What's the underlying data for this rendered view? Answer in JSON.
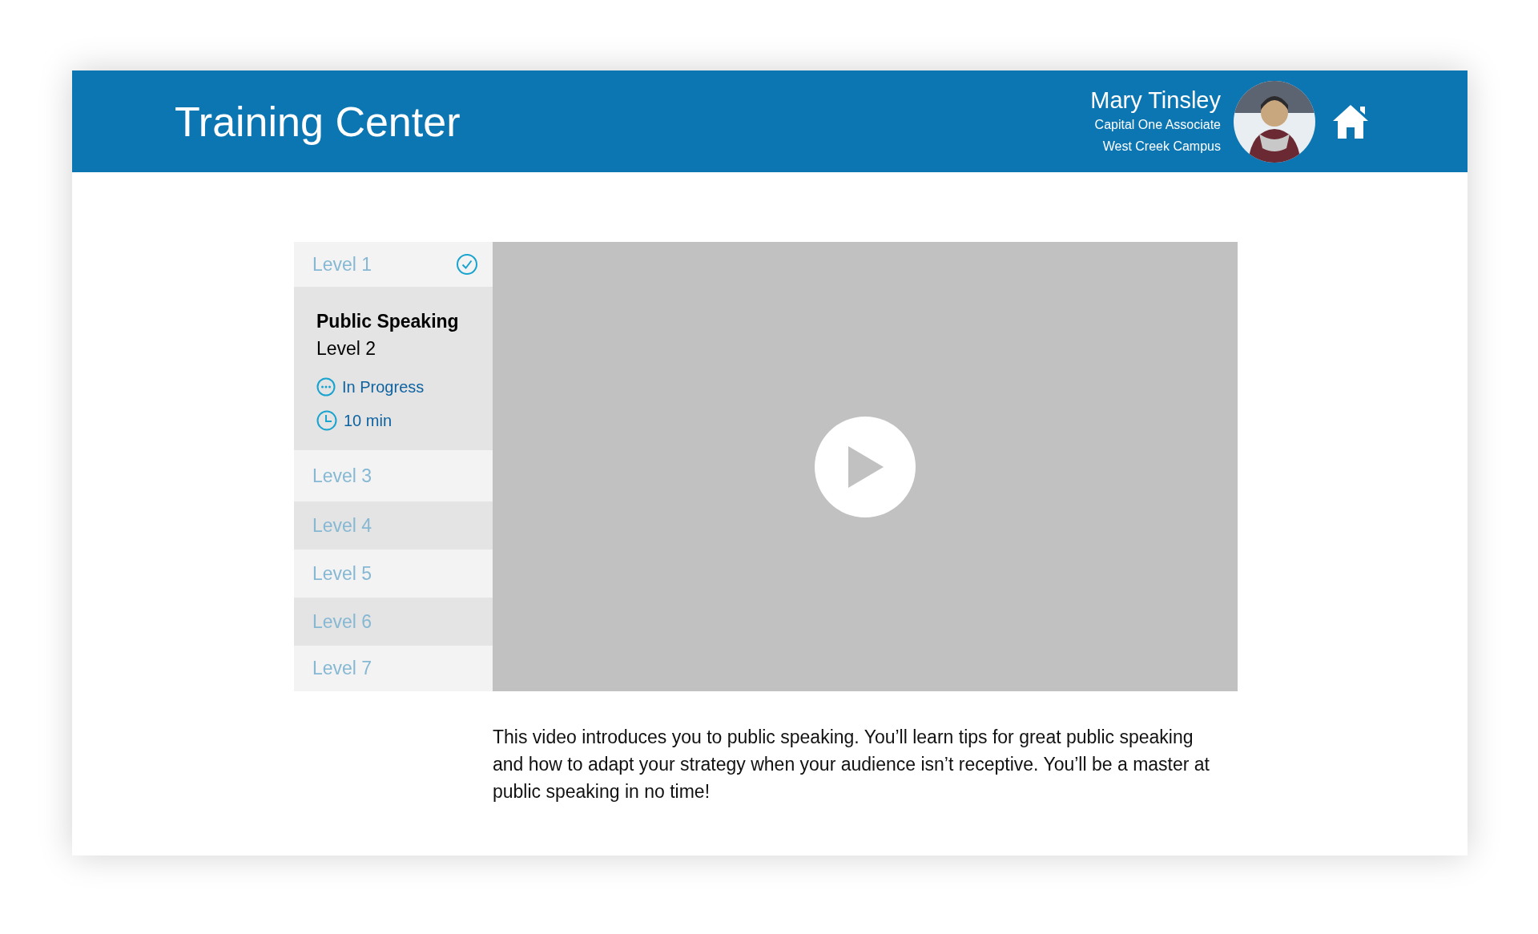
{
  "header": {
    "title": "Training Center",
    "user": {
      "name": "Mary Tinsley",
      "role": "Capital One Associate",
      "location": "West Creek Campus"
    }
  },
  "levels": [
    {
      "label": "Level 1",
      "completed": true,
      "selected": false
    },
    {
      "label": "Level 2",
      "completed": false,
      "selected": true,
      "course": "Public Speaking",
      "status": "In Progress",
      "duration": "10 min"
    },
    {
      "label": "Level 3",
      "completed": false,
      "selected": false
    },
    {
      "label": "Level 4",
      "completed": false,
      "selected": false
    },
    {
      "label": "Level 5",
      "completed": false,
      "selected": false
    },
    {
      "label": "Level 6",
      "completed": false,
      "selected": false
    },
    {
      "label": "Level 7",
      "completed": false,
      "selected": false
    }
  ],
  "description": "This video introduces you to public speaking. You’ll learn tips for great public speaking and how to adapt your strategy when your audience isn’t receptive. You’ll be a master at public speaking in no time!"
}
